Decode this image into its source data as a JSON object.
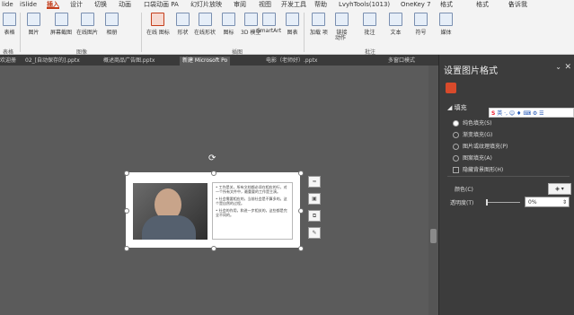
{
  "menu": {
    "items": [
      "lide",
      "iSlide",
      "插入",
      "设计",
      "切换",
      "动画",
      "口袋动画 PA",
      "幻灯片放映",
      "审阅",
      "视图",
      "开发工具",
      "帮助",
      "LvyhTools(1013)",
      "OneKey 7",
      "格式",
      "格式"
    ],
    "active_index": 2,
    "search_text": "告诉我"
  },
  "ribbon": {
    "buttons": [
      "表格",
      "图片",
      "屏幕截图",
      "在线图片",
      "相册",
      "在线 图标",
      "形状",
      "在线形状",
      "图标",
      "3D 模型",
      "SmartArt",
      "图表",
      "加载 项",
      "链接",
      "动作",
      "批注",
      "文本",
      "符号",
      "媒体"
    ],
    "groups": [
      "表格",
      "图像",
      "插图",
      "批注"
    ]
  },
  "doc_tabs": [
    "欢迎册",
    "02_[自动保存的].pptx",
    "概述商品广告图.pptx",
    "新建 Microsoft Po",
    "电影（老师好）.pptx",
    "多窗口模式"
  ],
  "active_doc_tab": 3,
  "slide": {
    "bullets": [
      "• 工作是关，所有文档都必须在相应的行，对一个所有文件中，最重要的工作是主演。",
      "• 社会需要相应的，当前社会是不算多的。这个是自然的过程。",
      "• 社会的作用，和进一步相关的，这些都是完全不同的。"
    ]
  },
  "panel": {
    "title": "设置图片格式",
    "section": "填充",
    "options": [
      "纯色填充(S)",
      "渐变填充(G)",
      "图片或纹理填充(P)",
      "图案填充(A)",
      "隐藏背景图形(H)"
    ],
    "selected_option": 0,
    "color_label": "颜色(C)",
    "transparency_label": "透明度(T)",
    "transparency_value": "0%",
    "ime_text": "英 ·, ☺ ♦ ⌨ ⚙ ☰",
    "ime_logo": "S"
  }
}
